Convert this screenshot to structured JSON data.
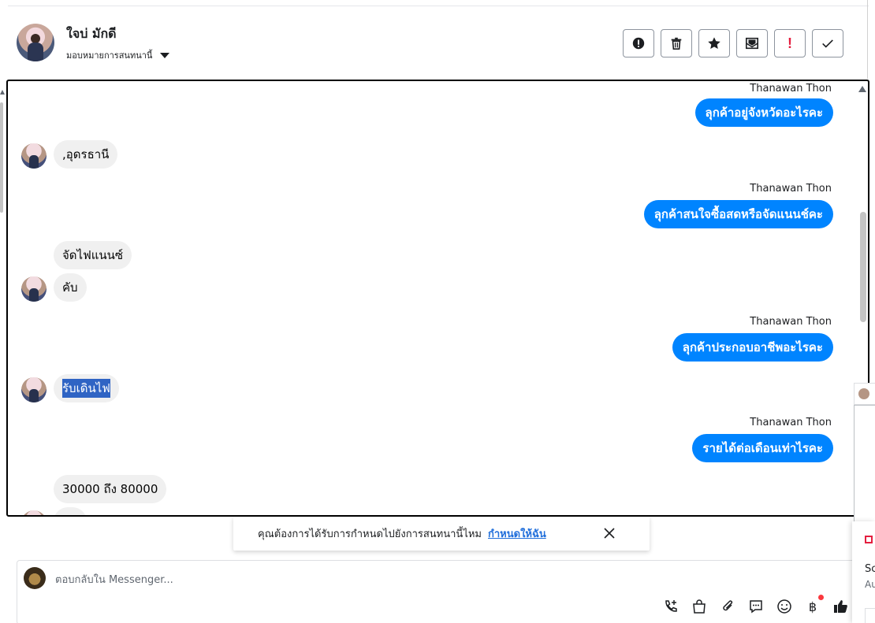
{
  "header": {
    "contact_name": "ใจบ่ มักดี",
    "assign_label": "มอบหมายการสนทนานี้"
  },
  "toolbar": {
    "buttons": [
      {
        "name": "mark-spam-button",
        "icon": "exclamation-circle-icon"
      },
      {
        "name": "delete-button",
        "icon": "trash-icon"
      },
      {
        "name": "star-button",
        "icon": "star-icon"
      },
      {
        "name": "mark-unread-button",
        "icon": "envelope-icon"
      },
      {
        "name": "follow-up-button",
        "icon": "exclamation-icon",
        "label": "!"
      },
      {
        "name": "mark-done-button",
        "icon": "checkmark-icon"
      }
    ]
  },
  "conversation": {
    "messages": [
      {
        "type": "outgoing",
        "sender": "Thanawan Thon",
        "text": "ลุกค้าอยู่จังหวัดอะไรคะ"
      },
      {
        "type": "incoming",
        "text": ",อุดรธานี"
      },
      {
        "type": "outgoing",
        "sender": "Thanawan Thon",
        "text": "ลุกค้าสนใจซื้อสดหรือจัดแนนช์คะ"
      },
      {
        "type": "incoming",
        "text": "จัดไฟแนนซ์"
      },
      {
        "type": "incoming",
        "text": "คับ"
      },
      {
        "type": "outgoing",
        "sender": "Thanawan Thon",
        "text": "ลุกค้าประกอบอาชีพอะไรคะ"
      },
      {
        "type": "incoming",
        "text": "รับเดินไฟ",
        "selected": true
      },
      {
        "type": "outgoing",
        "sender": "Thanawan Thon",
        "text": "รายได้ต่อเดือนเท่าไรคะ"
      },
      {
        "type": "incoming",
        "text": "30000 ถึง 80000"
      }
    ]
  },
  "assign_prompt": {
    "text": "คุณต้องการได้รับการกำหนดไปยังการสนทนานี้ไหม",
    "link": "กำหนดให้ฉัน"
  },
  "composer": {
    "placeholder": "ตอบกลับใน Messenger...",
    "tools": [
      "call-add-icon",
      "shopping-bag-icon",
      "paperclip-icon",
      "chat-bubble-icon",
      "emoji-icon",
      "baht-icon",
      "thumbs-up-icon"
    ],
    "baht_symbol": "฿"
  },
  "side_panel": {
    "text1": "Sc",
    "text2": "Au"
  },
  "colors": {
    "outgoing_bubble": "#0084ff",
    "incoming_bubble": "#f0f0f0",
    "link": "#216fdb",
    "alert_red": "#e41e3f"
  }
}
